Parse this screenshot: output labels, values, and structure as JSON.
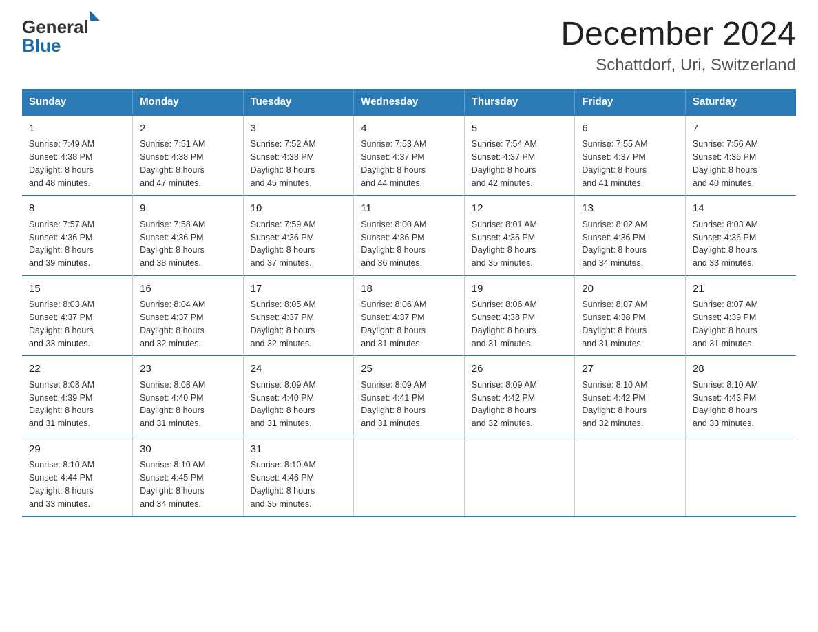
{
  "logo": {
    "general": "General",
    "blue": "Blue"
  },
  "title": "December 2024",
  "subtitle": "Schattdorf, Uri, Switzerland",
  "days_header": [
    "Sunday",
    "Monday",
    "Tuesday",
    "Wednesday",
    "Thursday",
    "Friday",
    "Saturday"
  ],
  "weeks": [
    [
      {
        "num": "1",
        "sunrise": "7:49 AM",
        "sunset": "4:38 PM",
        "daylight": "8 hours and 48 minutes."
      },
      {
        "num": "2",
        "sunrise": "7:51 AM",
        "sunset": "4:38 PM",
        "daylight": "8 hours and 47 minutes."
      },
      {
        "num": "3",
        "sunrise": "7:52 AM",
        "sunset": "4:38 PM",
        "daylight": "8 hours and 45 minutes."
      },
      {
        "num": "4",
        "sunrise": "7:53 AM",
        "sunset": "4:37 PM",
        "daylight": "8 hours and 44 minutes."
      },
      {
        "num": "5",
        "sunrise": "7:54 AM",
        "sunset": "4:37 PM",
        "daylight": "8 hours and 42 minutes."
      },
      {
        "num": "6",
        "sunrise": "7:55 AM",
        "sunset": "4:37 PM",
        "daylight": "8 hours and 41 minutes."
      },
      {
        "num": "7",
        "sunrise": "7:56 AM",
        "sunset": "4:36 PM",
        "daylight": "8 hours and 40 minutes."
      }
    ],
    [
      {
        "num": "8",
        "sunrise": "7:57 AM",
        "sunset": "4:36 PM",
        "daylight": "8 hours and 39 minutes."
      },
      {
        "num": "9",
        "sunrise": "7:58 AM",
        "sunset": "4:36 PM",
        "daylight": "8 hours and 38 minutes."
      },
      {
        "num": "10",
        "sunrise": "7:59 AM",
        "sunset": "4:36 PM",
        "daylight": "8 hours and 37 minutes."
      },
      {
        "num": "11",
        "sunrise": "8:00 AM",
        "sunset": "4:36 PM",
        "daylight": "8 hours and 36 minutes."
      },
      {
        "num": "12",
        "sunrise": "8:01 AM",
        "sunset": "4:36 PM",
        "daylight": "8 hours and 35 minutes."
      },
      {
        "num": "13",
        "sunrise": "8:02 AM",
        "sunset": "4:36 PM",
        "daylight": "8 hours and 34 minutes."
      },
      {
        "num": "14",
        "sunrise": "8:03 AM",
        "sunset": "4:36 PM",
        "daylight": "8 hours and 33 minutes."
      }
    ],
    [
      {
        "num": "15",
        "sunrise": "8:03 AM",
        "sunset": "4:37 PM",
        "daylight": "8 hours and 33 minutes."
      },
      {
        "num": "16",
        "sunrise": "8:04 AM",
        "sunset": "4:37 PM",
        "daylight": "8 hours and 32 minutes."
      },
      {
        "num": "17",
        "sunrise": "8:05 AM",
        "sunset": "4:37 PM",
        "daylight": "8 hours and 32 minutes."
      },
      {
        "num": "18",
        "sunrise": "8:06 AM",
        "sunset": "4:37 PM",
        "daylight": "8 hours and 31 minutes."
      },
      {
        "num": "19",
        "sunrise": "8:06 AM",
        "sunset": "4:38 PM",
        "daylight": "8 hours and 31 minutes."
      },
      {
        "num": "20",
        "sunrise": "8:07 AM",
        "sunset": "4:38 PM",
        "daylight": "8 hours and 31 minutes."
      },
      {
        "num": "21",
        "sunrise": "8:07 AM",
        "sunset": "4:39 PM",
        "daylight": "8 hours and 31 minutes."
      }
    ],
    [
      {
        "num": "22",
        "sunrise": "8:08 AM",
        "sunset": "4:39 PM",
        "daylight": "8 hours and 31 minutes."
      },
      {
        "num": "23",
        "sunrise": "8:08 AM",
        "sunset": "4:40 PM",
        "daylight": "8 hours and 31 minutes."
      },
      {
        "num": "24",
        "sunrise": "8:09 AM",
        "sunset": "4:40 PM",
        "daylight": "8 hours and 31 minutes."
      },
      {
        "num": "25",
        "sunrise": "8:09 AM",
        "sunset": "4:41 PM",
        "daylight": "8 hours and 31 minutes."
      },
      {
        "num": "26",
        "sunrise": "8:09 AM",
        "sunset": "4:42 PM",
        "daylight": "8 hours and 32 minutes."
      },
      {
        "num": "27",
        "sunrise": "8:10 AM",
        "sunset": "4:42 PM",
        "daylight": "8 hours and 32 minutes."
      },
      {
        "num": "28",
        "sunrise": "8:10 AM",
        "sunset": "4:43 PM",
        "daylight": "8 hours and 33 minutes."
      }
    ],
    [
      {
        "num": "29",
        "sunrise": "8:10 AM",
        "sunset": "4:44 PM",
        "daylight": "8 hours and 33 minutes."
      },
      {
        "num": "30",
        "sunrise": "8:10 AM",
        "sunset": "4:45 PM",
        "daylight": "8 hours and 34 minutes."
      },
      {
        "num": "31",
        "sunrise": "8:10 AM",
        "sunset": "4:46 PM",
        "daylight": "8 hours and 35 minutes."
      },
      null,
      null,
      null,
      null
    ]
  ],
  "labels": {
    "sunrise": "Sunrise: ",
    "sunset": "Sunset: ",
    "daylight": "Daylight: "
  }
}
